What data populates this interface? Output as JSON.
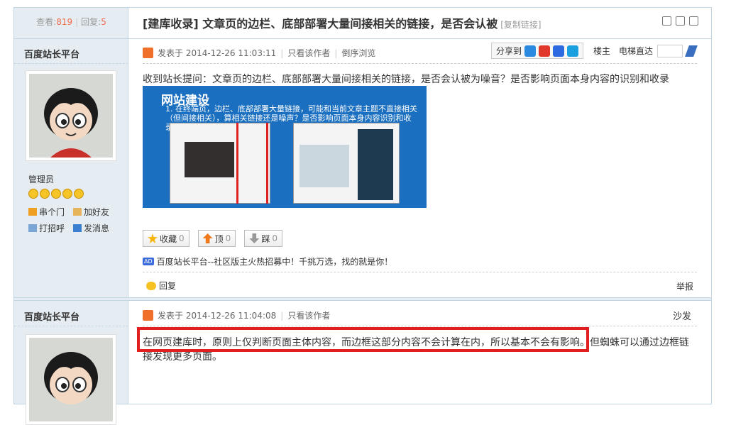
{
  "stats": {
    "views_label": "查看:",
    "views": "819",
    "replies_label": "回复:",
    "replies": "5"
  },
  "thread": {
    "title": "[建库收录] 文章页的边栏、底部部署大量间接相关的链接，是否会认被",
    "copy_link": "[复制链接]"
  },
  "post1": {
    "author": "百度站长平台",
    "posted": "发表于 2014-12-26 11:03:11",
    "only_author": "只看该作者",
    "reverse": "倒序浏览",
    "share_to": "分享到",
    "floor": "楼主",
    "elevator": "电梯直达",
    "body": "收到站长提问：文章页的边栏、底部部署大量间接相关的链接，是否会认被为噪音？是否影响页面本身内容的识别和收录",
    "banner_title": "网站建设",
    "banner_text_1": "1. 在终端页，边栏、底部部署大量链接，可能和当前文章主题不直接相关",
    "banner_text_2": "（但间接相关），算相关链接还是噪声？是否影响页面本身内容识别和收录？",
    "favorite_label": "收藏",
    "favorite_count": "0",
    "up_label": "顶",
    "up_count": "0",
    "down_label": "踩",
    "down_count": "0",
    "ad_tag": "AD",
    "ad_text": "百度站长平台--社区版主火热招募中！千挑万选，找的就是你！",
    "reply": "回复",
    "report": "举报"
  },
  "user1": {
    "role": "管理员",
    "home": "串个门",
    "add_friend": "加好友",
    "greet": "打招呼",
    "message": "发消息"
  },
  "post2": {
    "author": "百度站长平台",
    "posted": "发表于 2014-12-26 11:04:08",
    "only_author": "只看该作者",
    "floor": "沙发",
    "body_line1": "在网页建库时，原则上仅判断页面主体内容，而边框这部分内容不会计算在内，所以基本不会有影响。但蜘蛛可以通过边框链",
    "body_line2": "接发现更多页面。"
  },
  "colors": {
    "border": "#c2d5e3",
    "sidebar": "#e5edf2",
    "highlight": "#e02020"
  }
}
